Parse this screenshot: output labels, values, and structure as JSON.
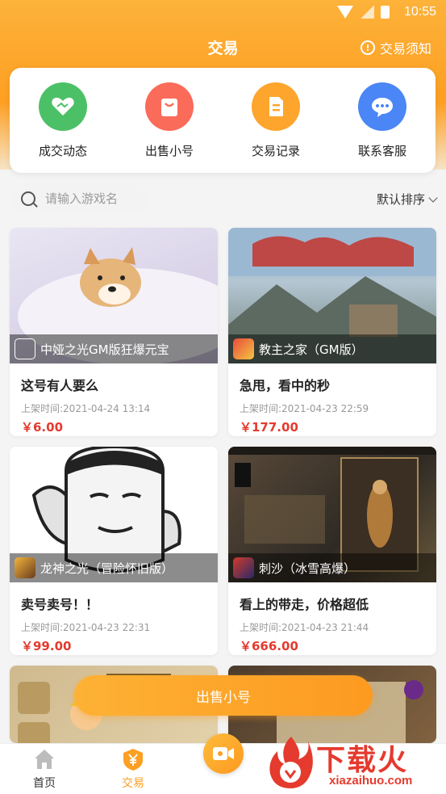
{
  "status": {
    "time": "10:55"
  },
  "header": {
    "title": "交易",
    "notice_label": "交易须知",
    "notice_icon": "info-icon"
  },
  "quick_actions": [
    {
      "label": "成交动态",
      "icon": "handshake-icon",
      "color": "#4cc067"
    },
    {
      "label": "出售小号",
      "icon": "bag-icon",
      "color": "#fb6b5a"
    },
    {
      "label": "交易记录",
      "icon": "document-icon",
      "color": "#fda52c"
    },
    {
      "label": "联系客服",
      "icon": "chat-icon",
      "color": "#4a86f5"
    }
  ],
  "search": {
    "placeholder": "请输入游戏名",
    "sort_label": "默认排序"
  },
  "listings": [
    {
      "game": "中娅之光GM版狂爆元宝",
      "title": "这号有人要么",
      "time": "上架时间:2021-04-24 13:14",
      "price": "￥6.00"
    },
    {
      "game": "教主之家（GM版）",
      "title": "急甩，看中的秒",
      "time": "上架时间:2021-04-23 22:59",
      "price": "￥177.00"
    },
    {
      "game": "龙神之光（冒险怀旧版）",
      "title": "卖号卖号！！",
      "time": "上架时间:2021-04-23 22:31",
      "price": "￥99.00"
    },
    {
      "game": "刺沙（冰雪高爆）",
      "title": "看上的带走，价格超低",
      "time": "上架时间:2021-04-23 21:44",
      "price": "￥666.00"
    }
  ],
  "sell_button": "出售小号",
  "tabs": [
    {
      "label": "首页",
      "icon": "home-icon",
      "active": false
    },
    {
      "label": "交易",
      "icon": "yen-shield-icon",
      "active": true
    }
  ],
  "center_button_icon": "video-icon",
  "watermark": {
    "text": "下载火",
    "url": "xiazaihuo.com"
  },
  "colors": {
    "accent": "#fd9f22",
    "price": "#e53a2e"
  }
}
